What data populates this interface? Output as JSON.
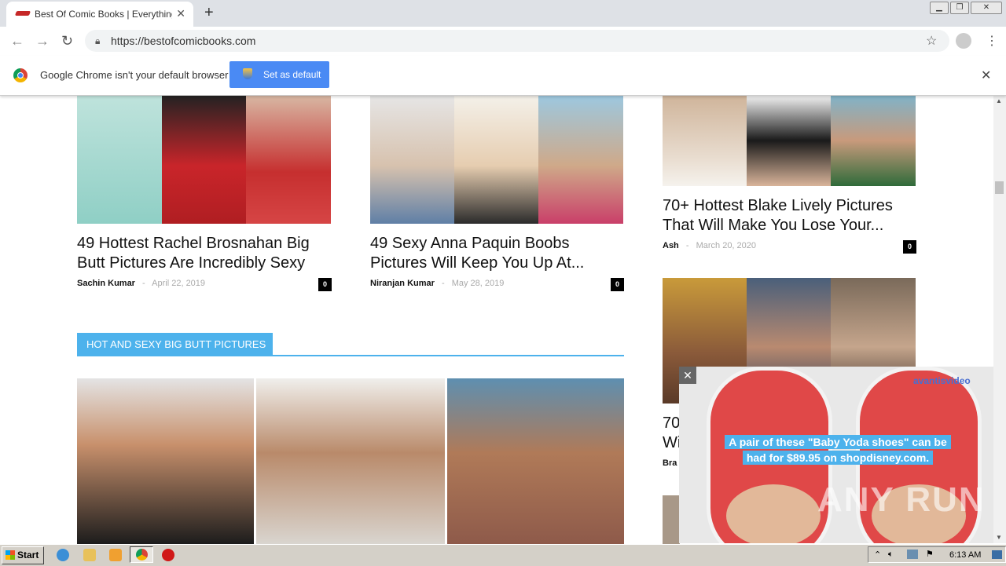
{
  "browser": {
    "tab_title": "Best Of Comic Books | Everything Ab",
    "tab_close": "✕",
    "new_tab": "+",
    "window_controls": [
      "▁",
      "❐",
      "✕"
    ],
    "url": "https://bestofcomicbooks.com",
    "infobar_text": "Google Chrome isn't your default browser",
    "set_default_label": "Set as default",
    "infobar_close": "✕"
  },
  "articles": [
    {
      "title_line1": "49 Hottest Rachel Brosnahan Big",
      "title_line2": "Butt Pictures Are Incredibly Sexy",
      "author": "Sachin Kumar",
      "sep": "-",
      "date": "April 22, 2019",
      "comments": "0"
    },
    {
      "title_line1": "49 Sexy Anna Paquin Boobs",
      "title_line2": "Pictures Will Keep You Up At...",
      "author": "Niranjan Kumar",
      "sep": "-",
      "date": "May 28, 2019",
      "comments": "0"
    },
    {
      "title_line1": "70+ Hottest Blake Lively Pictures",
      "title_line2": "That Will Make You Lose Your...",
      "author": "Ash",
      "sep": "-",
      "date": "March 20, 2020",
      "comments": "0"
    }
  ],
  "partial_article": {
    "line1": "70",
    "line2": "Wi",
    "author": "Bra"
  },
  "section": {
    "title": "HOT AND SEXY BIG BUTT PICTURES"
  },
  "ad": {
    "close": "✕",
    "logo": "avantisvideo",
    "caption_line1": "A pair of these \"Baby Yoda shoes\" can be",
    "caption_line2": "had for $89.95 on shopdisney.com.",
    "watermark": "ANY RUN"
  },
  "taskbar": {
    "start_label": "Start",
    "clock": "6:13 AM"
  },
  "colors": {
    "accent": "#4db2ec",
    "chrome_button": "#4a8af4"
  }
}
